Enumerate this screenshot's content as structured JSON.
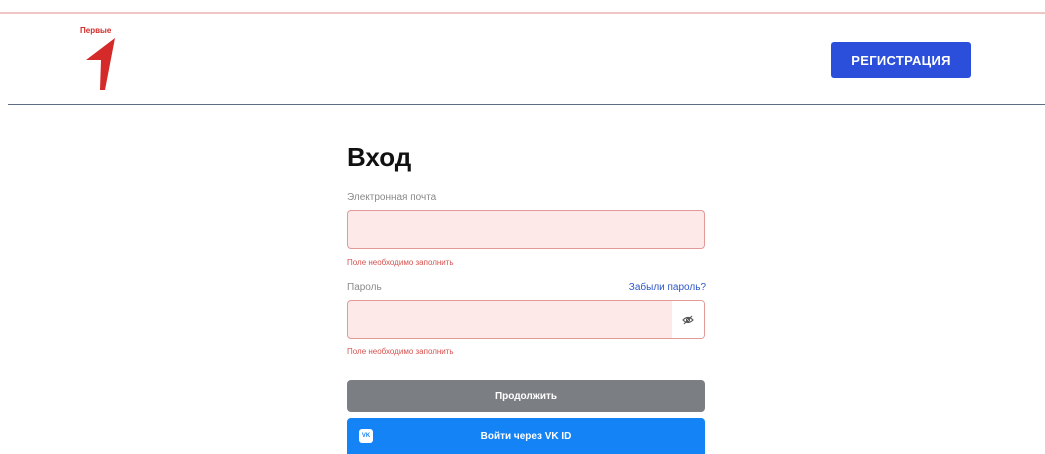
{
  "header": {
    "logo_text": "Первые",
    "register_label": "РЕГИСТРАЦИЯ"
  },
  "login": {
    "title": "Вход",
    "email_label": "Электронная почта",
    "email_value": "",
    "email_error": "Поле необходимо заполнить",
    "password_label": "Пароль",
    "forgot_label": "Забыли пароль?",
    "password_value": "",
    "password_error": "Поле необходимо заполнить",
    "continue_label": "Продолжить",
    "vk_label": "Войти через VK ID",
    "vk_icon_text": "VK"
  },
  "icons": {
    "logo": "pervye-logo",
    "password_toggle": "eye-off-icon",
    "vk": "vk-icon"
  },
  "colors": {
    "brand_red": "#d42a2a",
    "primary_blue": "#2c4fdb",
    "vk_blue": "#1483f5",
    "error": "#d5524f"
  }
}
